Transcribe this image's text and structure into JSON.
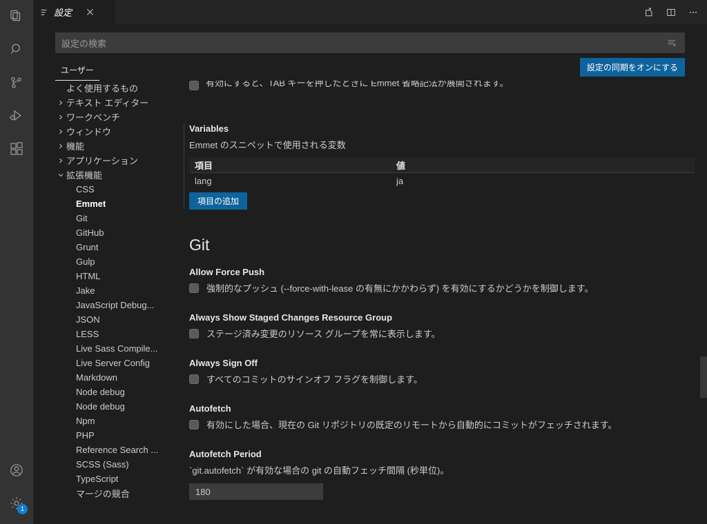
{
  "activitybar": {
    "items": [
      {
        "name": "explorer",
        "icon": "files-icon"
      },
      {
        "name": "search",
        "icon": "search-icon"
      },
      {
        "name": "source-control",
        "icon": "source-control-icon"
      },
      {
        "name": "run-and-debug",
        "icon": "run-debug-icon"
      },
      {
        "name": "extensions",
        "icon": "extensions-icon"
      }
    ],
    "bottom": [
      {
        "name": "accounts",
        "icon": "account-icon"
      },
      {
        "name": "manage",
        "icon": "gear-icon",
        "badge": "1"
      }
    ]
  },
  "tabbar": {
    "tab_label": "設定",
    "tab_icon": "settings-gear-list-icon",
    "close_icon": "close-icon",
    "actions": [
      {
        "name": "open-settings-json",
        "icon": "open-file-icon"
      },
      {
        "name": "split-editor",
        "icon": "split-editor-icon"
      },
      {
        "name": "more-actions",
        "icon": "ellipsis-icon"
      }
    ]
  },
  "search": {
    "placeholder": "設定の検索",
    "value": "",
    "clear_icon": "clear-filter-icon"
  },
  "settings_tabs": {
    "user_label": "ユーザー",
    "sync_button_label": "設定の同期をオンにする",
    "accent_color": "#0e639c"
  },
  "toc": {
    "items": [
      {
        "label": "よく使用するもの",
        "level": 0,
        "twisty": ""
      },
      {
        "label": "テキスト エディター",
        "level": 0,
        "twisty": "collapsed"
      },
      {
        "label": "ワークベンチ",
        "level": 0,
        "twisty": "collapsed"
      },
      {
        "label": "ウィンドウ",
        "level": 0,
        "twisty": "collapsed"
      },
      {
        "label": "機能",
        "level": 0,
        "twisty": "collapsed"
      },
      {
        "label": "アプリケーション",
        "level": 0,
        "twisty": "collapsed"
      },
      {
        "label": "拡張機能",
        "level": 0,
        "twisty": "expanded"
      },
      {
        "label": "CSS",
        "level": 1,
        "twisty": ""
      },
      {
        "label": "Emmet",
        "level": 1,
        "twisty": "",
        "selected": true
      },
      {
        "label": "Git",
        "level": 1,
        "twisty": ""
      },
      {
        "label": "GitHub",
        "level": 1,
        "twisty": ""
      },
      {
        "label": "Grunt",
        "level": 1,
        "twisty": ""
      },
      {
        "label": "Gulp",
        "level": 1,
        "twisty": ""
      },
      {
        "label": "HTML",
        "level": 1,
        "twisty": ""
      },
      {
        "label": "Jake",
        "level": 1,
        "twisty": ""
      },
      {
        "label": "JavaScript Debug...",
        "level": 1,
        "twisty": ""
      },
      {
        "label": "JSON",
        "level": 1,
        "twisty": ""
      },
      {
        "label": "LESS",
        "level": 1,
        "twisty": ""
      },
      {
        "label": "Live Sass Compile...",
        "level": 1,
        "twisty": ""
      },
      {
        "label": "Live Server Config",
        "level": 1,
        "twisty": ""
      },
      {
        "label": "Markdown",
        "level": 1,
        "twisty": ""
      },
      {
        "label": "Node debug",
        "level": 1,
        "twisty": ""
      },
      {
        "label": "Node debug",
        "level": 1,
        "twisty": ""
      },
      {
        "label": "Npm",
        "level": 1,
        "twisty": ""
      },
      {
        "label": "PHP",
        "level": 1,
        "twisty": ""
      },
      {
        "label": "Reference Search ...",
        "level": 1,
        "twisty": ""
      },
      {
        "label": "SCSS (Sass)",
        "level": 1,
        "twisty": ""
      },
      {
        "label": "TypeScript",
        "level": 1,
        "twisty": ""
      },
      {
        "label": "マージの競合",
        "level": 1,
        "twisty": ""
      }
    ]
  },
  "content": {
    "cut_setting_desc": "有効にすると、TAB キーを押したときに Emmet 省略記法が展開されます。",
    "variables": {
      "title": "Variables",
      "description": "Emmet のスニペットで使用される変数",
      "columns": [
        "項目",
        "値"
      ],
      "rows": [
        [
          "lang",
          "ja"
        ]
      ],
      "add_button_label": "項目の追加"
    },
    "git_section": {
      "heading": "Git",
      "settings": [
        {
          "title": "Allow Force Push",
          "description": "強制的なプッシュ (--force-with-lease の有無にかかわらず) を有効にするかどうかを制御します。",
          "type": "checkbox",
          "checked": false
        },
        {
          "title": "Always Show Staged Changes Resource Group",
          "description": "ステージ済み変更のリソース グループを常に表示します。",
          "type": "checkbox",
          "checked": false
        },
        {
          "title": "Always Sign Off",
          "description": "すべてのコミットのサインオフ フラグを制御します。",
          "type": "checkbox",
          "checked": false
        },
        {
          "title": "Autofetch",
          "description": "有効にした場合、現在の Git リポジトリの既定のリモートから自動的にコミットがフェッチされます。",
          "type": "checkbox",
          "checked": false
        },
        {
          "title": "Autofetch Period",
          "description": "`git.autofetch` が有効な場合の git の自動フェッチ間隔 (秒単位)。",
          "type": "number",
          "value": "180"
        }
      ]
    }
  }
}
